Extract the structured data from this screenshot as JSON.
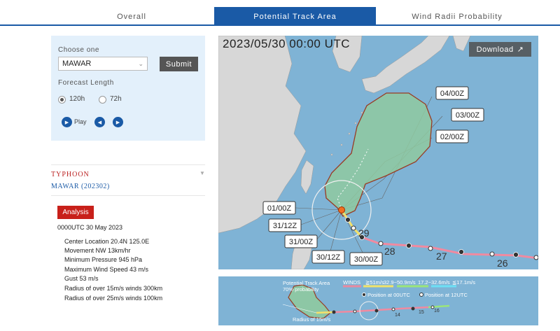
{
  "tabs": [
    "Overall",
    "Potential Track Area",
    "Wind Radii Probability"
  ],
  "panel": {
    "choose_label": "Choose one",
    "selected": "MAWAR",
    "submit_label": "Submit",
    "forecast_label": "Forecast Length",
    "opt_120": "120h",
    "opt_72": "72h",
    "play_label": "Play"
  },
  "storm": {
    "type": "TYPHOON",
    "name": "MAWAR (202302)",
    "analysis_label": "Analysis",
    "time": "0000UTC 30 May 2023",
    "details": [
      "Center Location 20.4N 125.0E",
      "Movement NW 13km/hr",
      "Minimum Pressure 945 hPa",
      "Maximum Wind Speed 43 m/s",
      "Gust 53 m/s",
      "Radius of over 15m/s winds 300km",
      "Radius of over 25m/s winds 100km"
    ]
  },
  "map": {
    "time": "2023/05/30 00:00 UTC",
    "download_label": "Download",
    "forecast_labels": [
      "04/00Z",
      "03/00Z",
      "02/00Z",
      "01/00Z",
      "31/12Z",
      "31/00Z",
      "30/12Z",
      "30/00Z"
    ],
    "past_day_labels": [
      "29",
      "28",
      "27",
      "26"
    ]
  },
  "legend": {
    "area_title": "Potential Track Area",
    "area_prob": "70% probability",
    "winds_label": "WINDS",
    "wind_bins": [
      "≧51m/s",
      "32.9~50.9m/s",
      "17.2~32.6m/s",
      "≦17.1m/s"
    ],
    "pos00": "Position at 00UTC",
    "pos12": "Position at 12UTC",
    "radius_label": "Radius of 15m/s",
    "days": [
      "14",
      "15",
      "16"
    ],
    "colors": {
      "w1": "#e88aa0",
      "w2": "#f1e36a",
      "w3": "#9be57a",
      "w4": "#6de0f5"
    }
  }
}
